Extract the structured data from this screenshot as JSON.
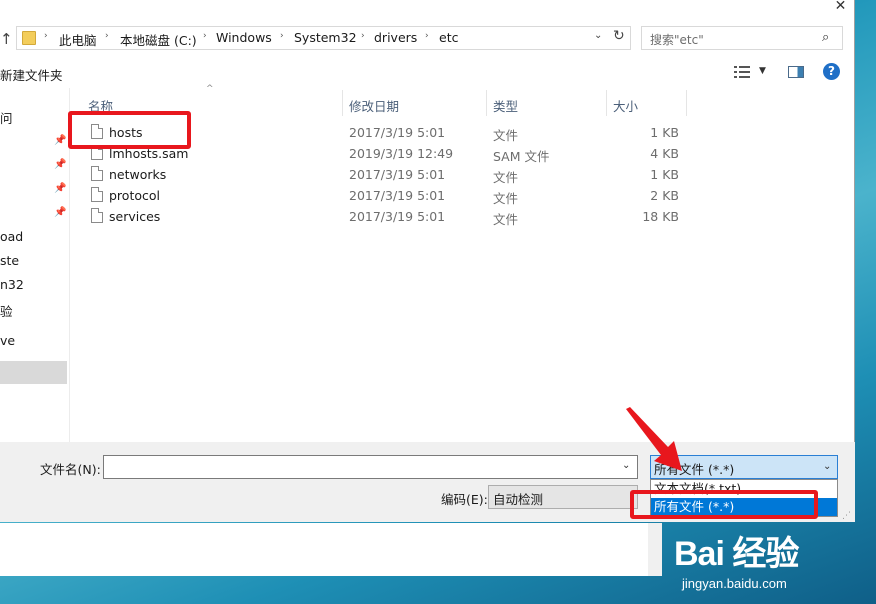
{
  "window": {
    "close_glyph": "✕"
  },
  "address": {
    "crumbs": [
      "此电脑",
      "本地磁盘 (C:)",
      "Windows",
      "System32",
      "drivers",
      "etc"
    ],
    "search_placeholder": "搜索\"etc\""
  },
  "toolbar": {
    "new_folder_label": "新建文件夹"
  },
  "nav_pane": {
    "items": [
      "问",
      "oad",
      "ste",
      "n32",
      "验",
      "ve"
    ]
  },
  "columns": {
    "name": "名称",
    "date": "修改日期",
    "type": "类型",
    "size": "大小"
  },
  "files": [
    {
      "name": "hosts",
      "date": "2017/3/19 5:01",
      "type": "文件",
      "size": "1 KB"
    },
    {
      "name": "lmhosts.sam",
      "date": "2019/3/19 12:49",
      "type": "SAM 文件",
      "size": "4 KB"
    },
    {
      "name": "networks",
      "date": "2017/3/19 5:01",
      "type": "文件",
      "size": "1 KB"
    },
    {
      "name": "protocol",
      "date": "2017/3/19 5:01",
      "type": "文件",
      "size": "2 KB"
    },
    {
      "name": "services",
      "date": "2017/3/19 5:01",
      "type": "文件",
      "size": "18 KB"
    }
  ],
  "save_form": {
    "filename_label": "文件名(N):",
    "filename_value": "",
    "encoding_label": "编码(E):",
    "encoding_value": "自动检测",
    "filetype_value": "所有文件  (*.*)",
    "filetype_options": [
      "文本文档(*.txt)",
      "所有文件  (*.*)"
    ]
  },
  "watermark": {
    "logo": "Bai 经验",
    "url": "jingyan.baidu.com"
  },
  "colors": {
    "annotation_red": "#e8171d",
    "selection_blue": "#0078d7"
  }
}
